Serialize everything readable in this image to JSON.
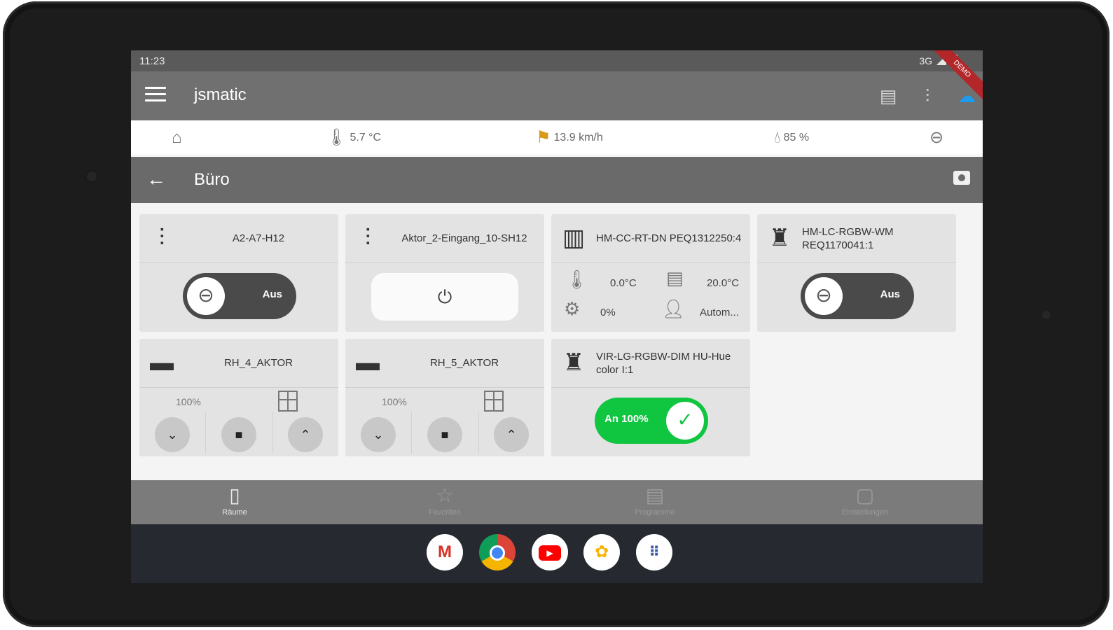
{
  "status_bar": {
    "time": "11:23",
    "network": "3G",
    "ribbon": "DEMO"
  },
  "app_bar": {
    "title": "jsmatic",
    "icons": [
      "menu-icon",
      "device-list-icon",
      "sliders-icon",
      "cloud-icon"
    ]
  },
  "weather": {
    "temperature": "5.7 °C",
    "wind": "13.9 km/h",
    "humidity": "85 %"
  },
  "room": {
    "title": "Büro"
  },
  "devices": [
    {
      "name": "A2-A7-H12",
      "type": "switch",
      "state_label": "Aus"
    },
    {
      "name": "Aktor_2-Eingang_10-SH12",
      "type": "power-button"
    },
    {
      "name": "HM-CC-RT-DN PEQ1312250:4",
      "type": "thermostat",
      "actual_temp": "0.0°C",
      "set_temp": "20.0°C",
      "valve": "0%",
      "mode": "Autom..."
    },
    {
      "name": "HM-LC-RGBW-WM REQ1170041:1",
      "type": "switch",
      "state_label": "Aus"
    },
    {
      "name": "RH_4_AKTOR",
      "type": "blind",
      "level": "100%"
    },
    {
      "name": "RH_5_AKTOR",
      "type": "blind",
      "level": "100%"
    },
    {
      "name": "VIR-LG-RGBW-DIM HU-Hue color I:1",
      "type": "switch",
      "state_label": "An 100%"
    }
  ],
  "bottom_nav": [
    {
      "label": "Räume",
      "icon": "door-icon",
      "active": true
    },
    {
      "label": "Favoriten",
      "icon": "star-icon",
      "active": false
    },
    {
      "label": "Programme",
      "icon": "document-icon",
      "active": false
    },
    {
      "label": "Einstellungen",
      "icon": "remote-icon",
      "active": false
    }
  ],
  "dock_apps": [
    "gmail-icon",
    "chrome-icon",
    "youtube-icon",
    "photos-icon",
    "app-drawer-icon"
  ],
  "colors": {
    "on_green": "#10c640",
    "appbar": "#707070",
    "roombar": "#6a6a6a",
    "card": "#e3e3e3"
  }
}
